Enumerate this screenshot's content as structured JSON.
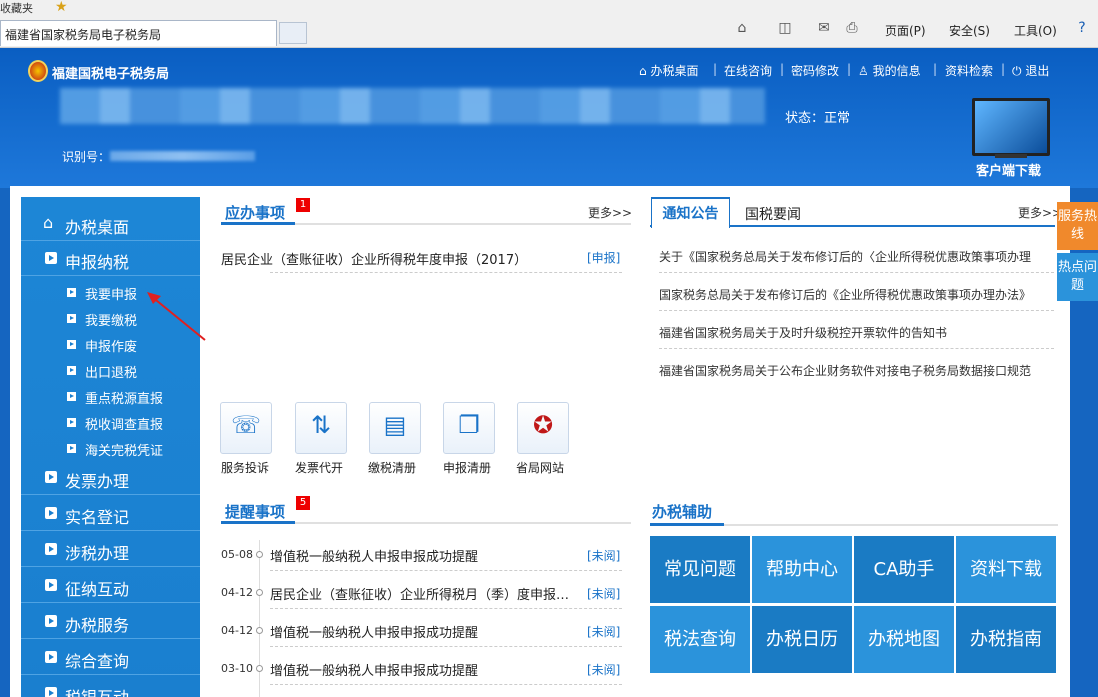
{
  "browser": {
    "favorites_label": "收藏夹",
    "tab_title": "福建省国家税务局电子税务局",
    "commands": [
      "页面(P)",
      "安全(S)",
      "工具(O)"
    ]
  },
  "header": {
    "site_title": "福建国税电子税务局",
    "links": [
      "办税桌面",
      "在线咨询",
      "密码修改",
      "我的信息",
      "资料检索",
      "退出"
    ],
    "status": "状态：正常",
    "id_label": "识别号：",
    "download_label": "客户端下载"
  },
  "sidebar": {
    "items": [
      {
        "label": "办税桌面"
      },
      {
        "label": "申报纳税"
      },
      {
        "label": "发票办理"
      },
      {
        "label": "实名登记"
      },
      {
        "label": "涉税办理"
      },
      {
        "label": "征纳互动"
      },
      {
        "label": "办税服务"
      },
      {
        "label": "综合查询"
      },
      {
        "label": "税银互动"
      }
    ],
    "subitems": [
      {
        "label": "我要申报"
      },
      {
        "label": "我要缴税"
      },
      {
        "label": "申报作废"
      },
      {
        "label": "出口退税"
      },
      {
        "label": "重点税源直报"
      },
      {
        "label": "税收调查直报"
      },
      {
        "label": "海关完税凭证"
      }
    ]
  },
  "todo": {
    "title": "应办事项",
    "badge": "1",
    "more": "更多>>",
    "item": "居民企业（查账征收）企业所得税年度申报（2017）",
    "action": "[申报]"
  },
  "quick": [
    {
      "label": "服务投诉",
      "icon": "service-complaint-icon"
    },
    {
      "label": "发票代开",
      "icon": "invoice-issue-icon"
    },
    {
      "label": "缴税清册",
      "icon": "tax-list-icon"
    },
    {
      "label": "申报清册",
      "icon": "declare-list-icon"
    },
    {
      "label": "省局网站",
      "icon": "emblem-icon"
    }
  ],
  "notice": {
    "tab_active": "通知公告",
    "tab_other": "国税要闻",
    "more": "更多>>",
    "items": [
      "关于《国家税务总局关于发布修订后的〈企业所得税优惠政策事项办理",
      "国家税务总局关于发布修订后的《企业所得税优惠政策事项办理办法》",
      "福建省国家税务局关于及时升级税控开票软件的告知书",
      "福建省国家税务局关于公布企业财务软件对接电子税务局数据接口规范"
    ]
  },
  "remind": {
    "title": "提醒事项",
    "badge": "5",
    "items": [
      {
        "date": "05-08",
        "text": "增值税一般纳税人申报申报成功提醒",
        "status": "[未阅]"
      },
      {
        "date": "04-12",
        "text": "居民企业（查账征收）企业所得税月（季）度申报成功提醒",
        "status": "[未阅]"
      },
      {
        "date": "04-12",
        "text": "增值税一般纳税人申报申报成功提醒",
        "status": "[未阅]"
      },
      {
        "date": "03-10",
        "text": "增值税一般纳税人申报申报成功提醒",
        "status": "[未阅]"
      }
    ]
  },
  "assist": {
    "title": "办税辅助",
    "tiles": [
      "常见问题",
      "帮助中心",
      "CA助手",
      "资料下载",
      "税法查询",
      "办税日历",
      "办税地图",
      "办税指南"
    ]
  },
  "float": [
    "服务热线",
    "热点问题"
  ],
  "colors": {
    "brand": "#1565c0",
    "accent": "#1a73c8",
    "tile_dark": "#1a7bc4",
    "tile_light": "#2b93db",
    "float": "#f0892c"
  }
}
